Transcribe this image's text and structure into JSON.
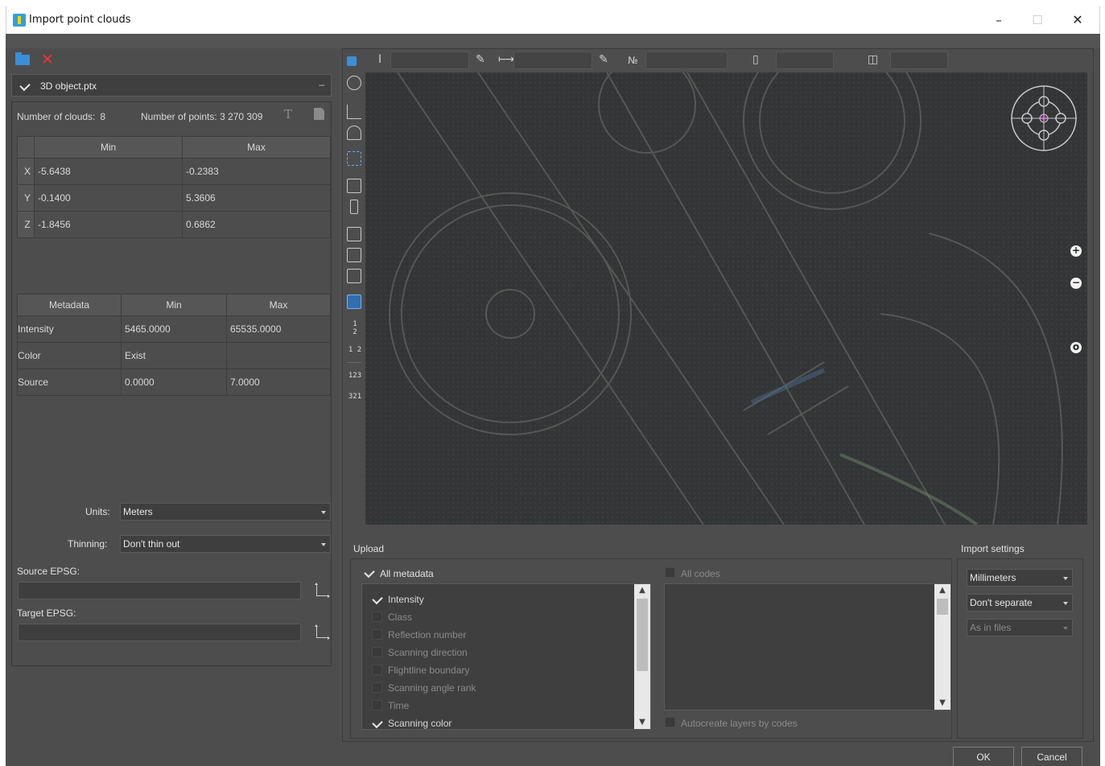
{
  "window": {
    "title": "Import point clouds",
    "controls": {
      "minimize": "–",
      "maximize": "☐",
      "close": "✕"
    }
  },
  "file": {
    "name": "3D object.ptx",
    "checked": true,
    "collapse": "–"
  },
  "stats": {
    "clouds_label": "Number of clouds:",
    "clouds_value": "8",
    "points_label": "Number of points:",
    "points_value": "3 270 309"
  },
  "minmax": {
    "headers": [
      "Min",
      "Max"
    ],
    "rows": [
      {
        "axis": "X",
        "min": "-5.6438",
        "max": "-0.2383"
      },
      {
        "axis": "Y",
        "min": "-0.1400",
        "max": "5.3606"
      },
      {
        "axis": "Z",
        "min": "-1.8456",
        "max": "0.6862"
      }
    ]
  },
  "metadata": {
    "headers": [
      "Metadata",
      "Min",
      "Max"
    ],
    "rows": [
      {
        "name": "Intensity",
        "min": "5465.0000",
        "max": "65535.0000"
      },
      {
        "name": "Color",
        "min": "Exist",
        "max": ""
      },
      {
        "name": "Source",
        "min": "0.0000",
        "max": "7.0000"
      }
    ]
  },
  "units": {
    "label": "Units:",
    "value": "Meters"
  },
  "thinning": {
    "label": "Thinning:",
    "value": "Don't thin out"
  },
  "source_epsg": {
    "label": "Source EPSG:",
    "value": ""
  },
  "target_epsg": {
    "label": "Target EPSG:",
    "value": ""
  },
  "measure_bar": {
    "number_sign": "№"
  },
  "upload": {
    "label": "Upload",
    "all_metadata": "All metadata",
    "all_codes": "All codes",
    "items": [
      {
        "label": "Intensity",
        "checked": true,
        "enabled": true
      },
      {
        "label": "Class",
        "checked": false,
        "enabled": false
      },
      {
        "label": "Reflection number",
        "checked": false,
        "enabled": false
      },
      {
        "label": "Scanning direction",
        "checked": false,
        "enabled": false
      },
      {
        "label": "Flightline boundary",
        "checked": false,
        "enabled": false
      },
      {
        "label": "Scanning angle rank",
        "checked": false,
        "enabled": false
      },
      {
        "label": "Time",
        "checked": false,
        "enabled": false
      },
      {
        "label": "Scanning color",
        "checked": true,
        "enabled": true
      }
    ],
    "autocreate": "Autocreate layers by codes"
  },
  "import_settings": {
    "label": "Import settings",
    "units": "Millimeters",
    "separate": "Don't separate",
    "layers": "As in files"
  },
  "vert_toolbar": {
    "num1": "1",
    "num2": "2",
    "num12": "1 2",
    "num123": "123",
    "num321": "321"
  },
  "buttons": {
    "ok": "OK",
    "cancel": "Cancel"
  },
  "colors": {
    "background": "#4d4d4d",
    "viewport": "#333536",
    "accent": "#2f6fb0",
    "close_x": "#e33333"
  }
}
